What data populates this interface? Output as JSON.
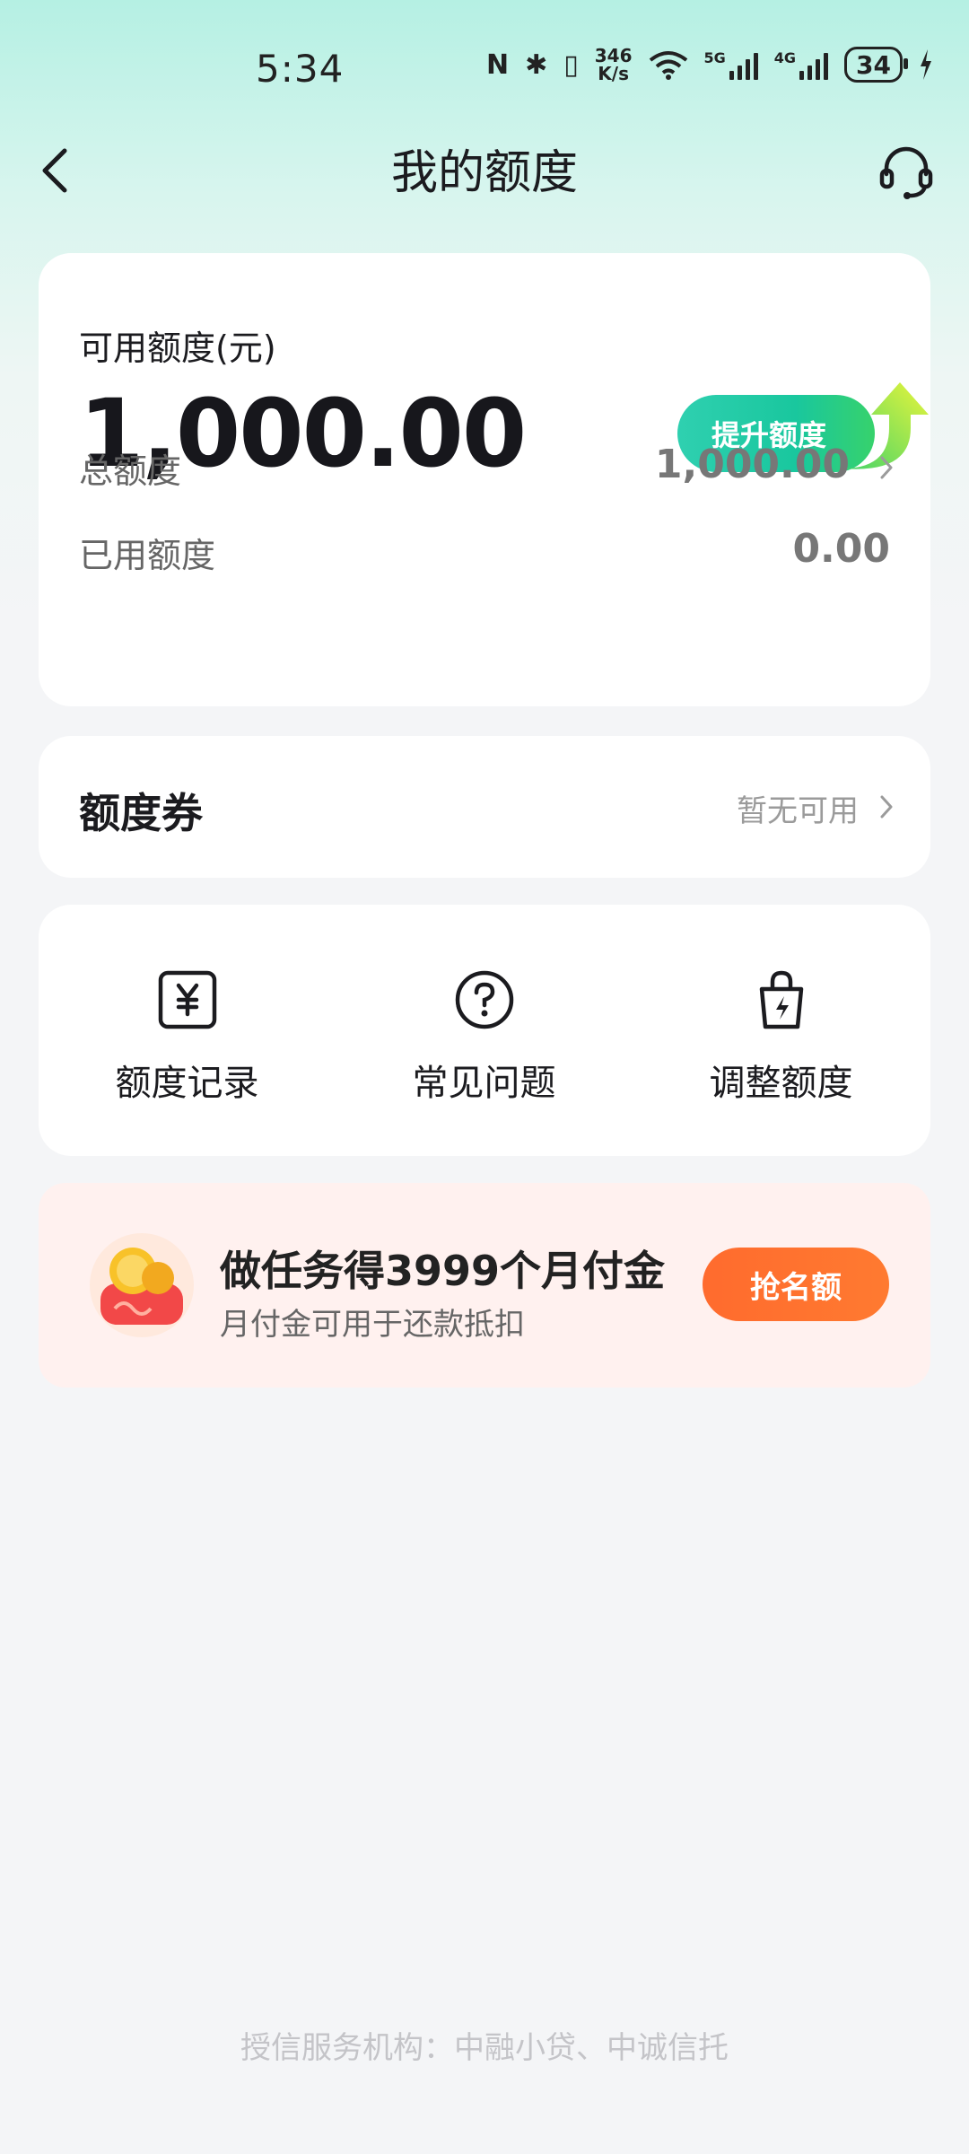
{
  "status_bar": {
    "time": "5:34",
    "nfc": "N",
    "bluetooth": "✱",
    "vibrate": "▯",
    "net_speed_top": "346",
    "net_speed_bottom": "K/s",
    "sig1_label": "5G",
    "sig2_label": "4G",
    "battery": "34"
  },
  "header": {
    "title": "我的额度"
  },
  "quota_card": {
    "available_label": "可用额度(元)",
    "available_value": "1,000.00",
    "raise_button": "提升额度",
    "total_label": "总额度",
    "total_value": "1,000.00",
    "used_label": "已用额度",
    "used_value": "0.00"
  },
  "coupon_card": {
    "label": "额度券",
    "status": "暂无可用"
  },
  "quick_actions": [
    {
      "label": "额度记录",
      "icon": "yuan-record-icon"
    },
    {
      "label": "常见问题",
      "icon": "question-icon"
    },
    {
      "label": "调整额度",
      "icon": "bag-lightning-icon"
    }
  ],
  "promo": {
    "title": "做任务得3999个月付金",
    "subtitle": "月付金可用于还款抵扣",
    "button": "抢名额"
  },
  "footer": {
    "text": "授信服务机构：中融小贷、中诚信托"
  },
  "colors": {
    "accent_green": "#19c79e",
    "promo_orange": "#ff6b2e",
    "header_bg": "#b5f0e3"
  }
}
